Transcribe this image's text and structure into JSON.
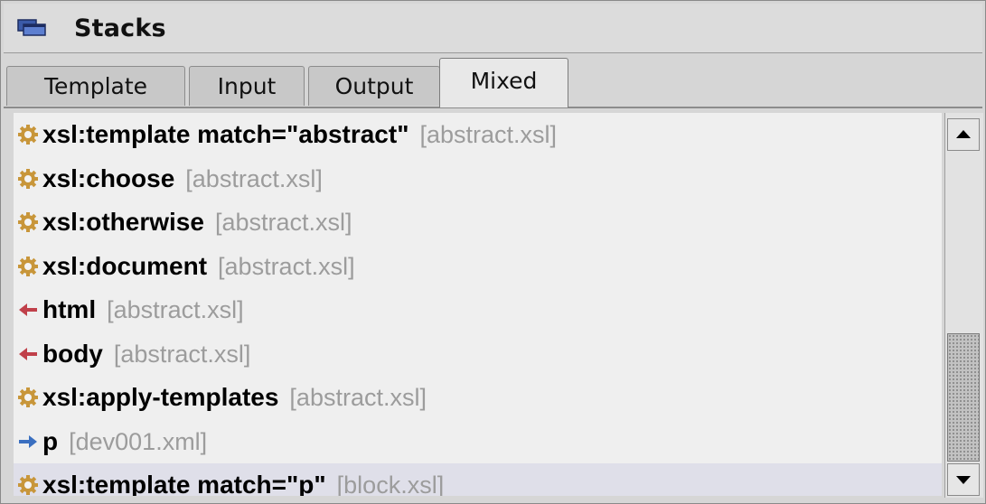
{
  "panel": {
    "title": "Stacks",
    "title_icon": "stack-windows-icon"
  },
  "tabs": [
    {
      "label": "Template",
      "active": false
    },
    {
      "label": "Input",
      "active": false
    },
    {
      "label": "Output",
      "active": false
    },
    {
      "label": "Mixed",
      "active": true
    }
  ],
  "rows": [
    {
      "icon": "gear-icon",
      "name": "xsl:template match=\"abstract\"",
      "file": "[abstract.xsl]",
      "selected": false
    },
    {
      "icon": "gear-icon",
      "name": "xsl:choose",
      "file": "[abstract.xsl]",
      "selected": false
    },
    {
      "icon": "gear-icon",
      "name": "xsl:otherwise",
      "file": "[abstract.xsl]",
      "selected": false
    },
    {
      "icon": "gear-icon",
      "name": "xsl:document",
      "file": "[abstract.xsl]",
      "selected": false
    },
    {
      "icon": "arrow-left-red-icon",
      "name": "html",
      "file": "[abstract.xsl]",
      "selected": false
    },
    {
      "icon": "arrow-left-red-icon",
      "name": "body",
      "file": "[abstract.xsl]",
      "selected": false
    },
    {
      "icon": "gear-icon",
      "name": "xsl:apply-templates",
      "file": "[abstract.xsl]",
      "selected": false
    },
    {
      "icon": "arrow-right-blue-icon",
      "name": "p",
      "file": "[dev001.xml]",
      "selected": false
    },
    {
      "icon": "gear-icon",
      "name": "xsl:template match=\"p\"",
      "file": "[block.xsl]",
      "selected": true
    }
  ],
  "colors": {
    "gear": "#c8963a",
    "arrow_left": "#c0404a",
    "arrow_right": "#3a6fc0",
    "file_text": "#9c9c9c",
    "selected_row": "#dfdfe9"
  }
}
